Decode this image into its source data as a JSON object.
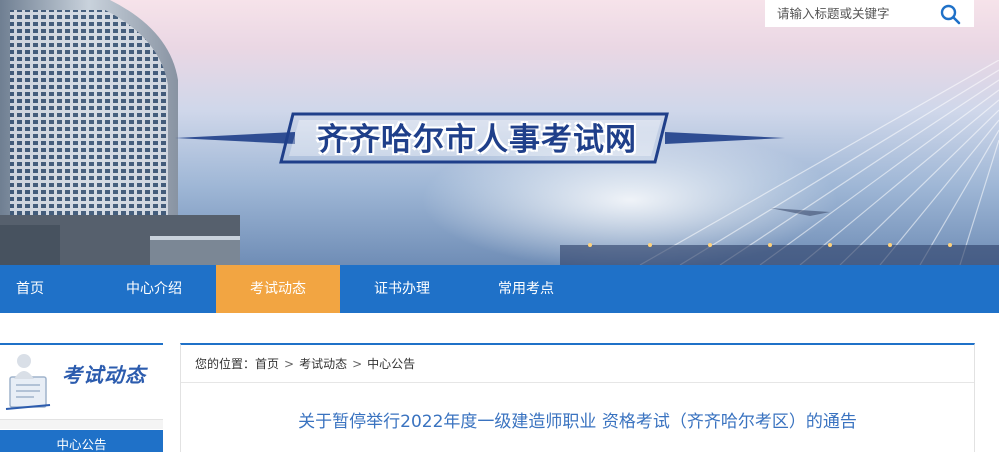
{
  "site": {
    "title": "齐齐哈尔市人事考试网"
  },
  "search": {
    "placeholder": "请输入标题或关键字",
    "icon": "search-icon"
  },
  "nav": {
    "items": [
      {
        "label": "首页",
        "active": false
      },
      {
        "label": "中心介绍",
        "active": false
      },
      {
        "label": "考试动态",
        "active": true
      },
      {
        "label": "证书办理",
        "active": false
      },
      {
        "label": "常用考点",
        "active": false
      }
    ]
  },
  "sidebar": {
    "heading": "考试动态",
    "active_item": "中心公告"
  },
  "breadcrumb": {
    "prefix": "您的位置：",
    "items": [
      "首页",
      "考试动态",
      "中心公告"
    ],
    "separator": ">"
  },
  "article": {
    "title": "关于暂停举行2022年度一级建造师职业 资格考试（齐齐哈尔考区）的通告"
  },
  "colors": {
    "nav_bg": "#1f71c8",
    "nav_active": "#f2a542",
    "title_blue": "#1f3f8a",
    "article_title": "#3a73c0"
  }
}
